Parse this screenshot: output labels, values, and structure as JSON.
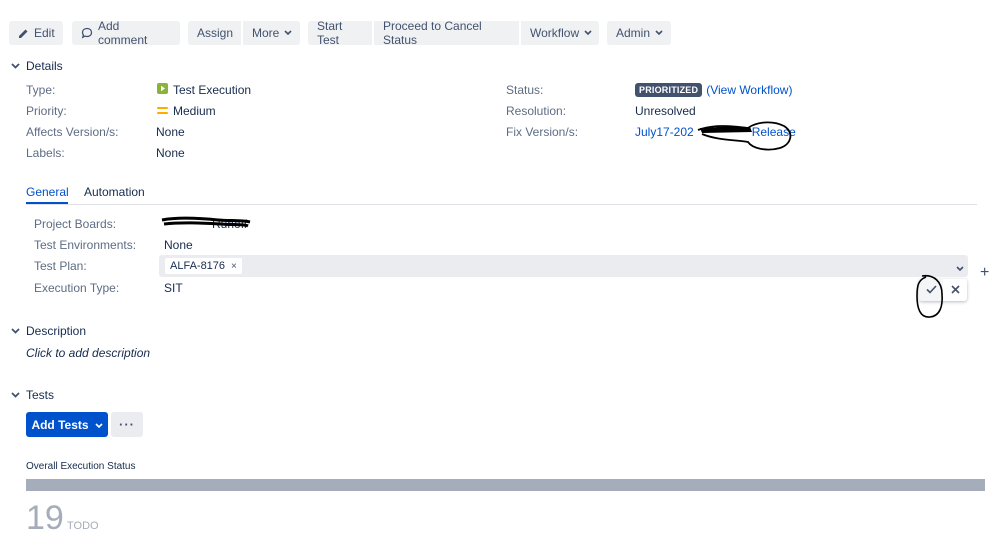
{
  "toolbar": {
    "edit": "Edit",
    "add_comment": "Add comment",
    "assign": "Assign",
    "more": "More",
    "start_test": "Start Test",
    "proceed_cancel": "Proceed to Cancel Status",
    "workflow": "Workflow",
    "admin": "Admin"
  },
  "details": {
    "heading": "Details",
    "type_label": "Type:",
    "type_value": "Test Execution",
    "priority_label": "Priority:",
    "priority_value": "Medium",
    "affects_label": "Affects Version/s:",
    "affects_value": "None",
    "labels_label": "Labels:",
    "labels_value": "None",
    "status_label": "Status:",
    "status_value": "PRIORITIZED",
    "view_workflow": "(View Workflow)",
    "resolution_label": "Resolution:",
    "resolution_value": "Unresolved",
    "fix_label": "Fix Version/s:",
    "fix_value_start": "July17-202",
    "fix_value_end": "Release"
  },
  "tabs": {
    "general": "General",
    "automation": "Automation"
  },
  "general": {
    "boards_label": "Project Boards:",
    "boards_value_tail": "Runoff",
    "env_label": "Test Environments:",
    "env_value": "None",
    "plan_label": "Test Plan:",
    "plan_chip": "ALFA-8176",
    "plan_chip_remove": "×",
    "exec_label": "Execution Type:",
    "exec_value": "SIT",
    "add_symbol": "+"
  },
  "description": {
    "heading": "Description",
    "placeholder": "Click to add description"
  },
  "tests": {
    "heading": "Tests",
    "add_tests": "Add Tests",
    "more": "···",
    "overall_label": "Overall Execution Status",
    "count": "19",
    "count_label": "TODO"
  },
  "colors": {
    "primary": "#0052cc",
    "status_bar": "#a5adba",
    "type_icon": "#8bb33b",
    "priority_icon": "#ffab00"
  }
}
